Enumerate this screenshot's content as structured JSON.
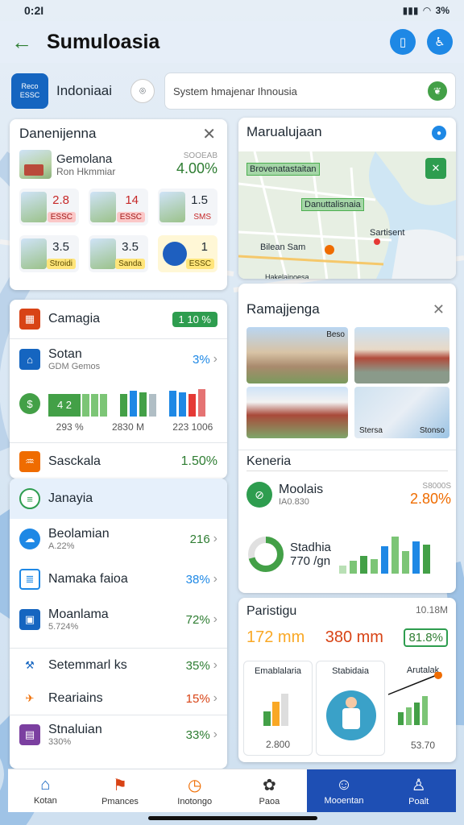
{
  "status": {
    "time": "0:2I",
    "battery": "3%"
  },
  "header": {
    "title": "Sumuloasia"
  },
  "location": {
    "logo_line1": "Reco",
    "logo_line2": "ESSC",
    "name": "Indoniaai",
    "search_placeholder": "System hmajenar Ihnousia"
  },
  "card_left_top": {
    "title": "Danenijenna",
    "feature": {
      "name": "Gemolana",
      "sub": "Ron Hkmmiar",
      "small": "SOOEAB",
      "value": "4.00%"
    },
    "tiles": [
      {
        "num": "2.8",
        "tag": "ESSC",
        "style": "red"
      },
      {
        "num": "14",
        "tag": "ESSC",
        "style": "red"
      },
      {
        "num": "1.5",
        "tag": "SMS",
        "style": "plain"
      },
      {
        "num": "3.5",
        "tag": "Stroidi",
        "style": "yellow"
      },
      {
        "num": "3.5",
        "tag": "Sanda",
        "style": "yellow"
      },
      {
        "num": "1",
        "tag": "ESSC",
        "style": "yellow"
      }
    ]
  },
  "map_card": {
    "title": "Marualujaan",
    "labels": [
      "Brovenatastaitan",
      "Danuttalisnaia",
      "Sartisent",
      "Bilean Sam",
      "Hakelajnoesa"
    ]
  },
  "stats_card": {
    "row1": {
      "label": "Camagia",
      "pill": "1 10 %"
    },
    "row2": {
      "label": "Sotan",
      "sub": "GDM Gemos",
      "value": "3%"
    },
    "bars_a_value": "4 2",
    "bars_caption": [
      "293 %",
      "2830 M",
      "223 1006"
    ],
    "row3": {
      "label": "Sasckala",
      "value": "1.50%"
    }
  },
  "list_card": {
    "head": "Janayia",
    "items": [
      {
        "name": "Beolamian",
        "sub": "A.22%",
        "value": "216",
        "color": "green"
      },
      {
        "name": "Namaka faioa",
        "sub": "",
        "value": "38%",
        "color": "blue"
      },
      {
        "name": "Moanlama",
        "sub": "5.724%",
        "value": "72%",
        "color": "green"
      },
      {
        "name": "Setemmarl ks",
        "sub": "",
        "value": "35%",
        "color": "green"
      },
      {
        "name": "Reariains",
        "sub": "",
        "value": "15%",
        "color": "red"
      },
      {
        "name": "Stnaluian",
        "sub": "330%",
        "value": "33%",
        "color": "green"
      }
    ]
  },
  "photo_card": {
    "title": "Ramajjenga",
    "photo_labels": [
      "Beso",
      "Stersa",
      "Stonso"
    ],
    "section": "Keneria",
    "kat": {
      "name": "Moolais",
      "sub": "IA0.830",
      "small": "S8000S",
      "value": "2.80%"
    },
    "donut": {
      "name": "Stadhia",
      "value": "770 /gn"
    }
  },
  "stats_card2": {
    "title": "Paristigu",
    "small": "10.18M",
    "v1": "172 mm",
    "v2": "380 mm",
    "v3": "81.8%",
    "cards": [
      {
        "title": "Emablalaria",
        "value": "2.800"
      },
      {
        "title": "Stabidaia",
        "value": ""
      },
      {
        "title": "Arutalak",
        "value": "53.70"
      }
    ]
  },
  "nav": [
    {
      "label": "Kotan",
      "icon": "home"
    },
    {
      "label": "Pmances",
      "icon": "flag"
    },
    {
      "label": "Inotongo",
      "icon": "clock"
    },
    {
      "label": "Paoa",
      "icon": "flower"
    },
    {
      "label": "Mooentan",
      "icon": "chat"
    },
    {
      "label": "Poalt",
      "icon": "person"
    }
  ],
  "colors": {
    "accent_blue": "#1e4fb4",
    "green": "#2e7d32",
    "red": "#d84315",
    "orange": "#ef6c00"
  }
}
